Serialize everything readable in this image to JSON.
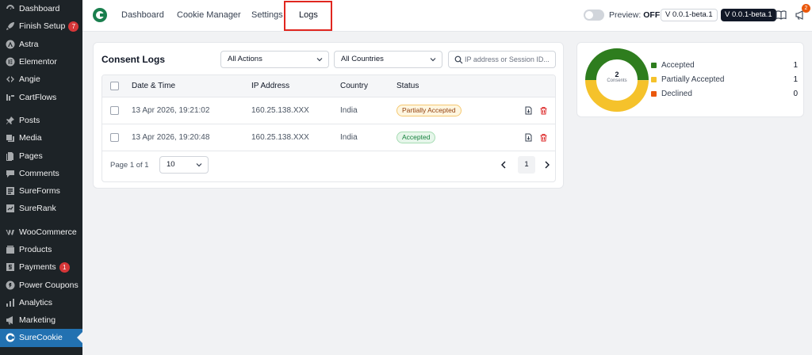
{
  "wp_sidebar": {
    "items": [
      {
        "label": "Dashboard",
        "icon": "dashboard-icon"
      },
      {
        "label": "Finish Setup",
        "icon": "rocket-icon",
        "badge": "7"
      },
      {
        "label": "Astra",
        "icon": "astra-icon"
      },
      {
        "label": "Elementor",
        "icon": "elementor-icon"
      },
      {
        "label": "Angie",
        "icon": "angie-icon"
      },
      {
        "label": "CartFlows",
        "icon": "cartflows-icon"
      },
      {
        "label": "Posts",
        "icon": "pin-icon"
      },
      {
        "label": "Media",
        "icon": "media-icon"
      },
      {
        "label": "Pages",
        "icon": "pages-icon"
      },
      {
        "label": "Comments",
        "icon": "comment-icon"
      },
      {
        "label": "SureForms",
        "icon": "sureforms-icon"
      },
      {
        "label": "SureRank",
        "icon": "surerank-icon"
      },
      {
        "label": "WooCommerce",
        "icon": "woocommerce-icon"
      },
      {
        "label": "Products",
        "icon": "products-icon"
      },
      {
        "label": "Payments",
        "icon": "payments-icon",
        "badge": "1"
      },
      {
        "label": "Power Coupons",
        "icon": "coupon-icon"
      },
      {
        "label": "Analytics",
        "icon": "analytics-icon"
      },
      {
        "label": "Marketing",
        "icon": "megaphone-icon"
      },
      {
        "label": "SureCookie",
        "icon": "surecookie-icon"
      }
    ]
  },
  "topnav": {
    "tabs": [
      {
        "label": "Dashboard"
      },
      {
        "label": "Cookie Manager"
      },
      {
        "label": "Settings"
      },
      {
        "label": "Logs"
      }
    ],
    "active_tab": "Logs",
    "preview_label": "Preview:",
    "preview_state": "OFF",
    "version_outline": "V 0.0.1-beta.1",
    "version_dark": "V 0.0.1-beta.1",
    "notification_count": "2"
  },
  "logs": {
    "title": "Consent Logs",
    "filter_actions": "All Actions",
    "filter_countries": "All Countries",
    "search_placeholder": "IP address or Session ID...",
    "columns": [
      "Date & Time",
      "IP Address",
      "Country",
      "Status"
    ],
    "rows": [
      {
        "datetime": "13 Apr 2026, 19:21:02",
        "ip": "160.25.138.XXX",
        "country": "India",
        "status": "Partially Accepted"
      },
      {
        "datetime": "13 Apr 2026, 19:20:48",
        "ip": "160.25.138.XXX",
        "country": "India",
        "status": "Accepted"
      }
    ],
    "page_info": "Page 1 of 1",
    "per_page": "10",
    "current_page": "1"
  },
  "summary": {
    "total": "2",
    "total_label": "Consents",
    "items": [
      {
        "label": "Accepted",
        "count": "1",
        "color": "#2e7d1e"
      },
      {
        "label": "Partially Accepted",
        "count": "1",
        "color": "#f5c22b"
      },
      {
        "label": "Declined",
        "count": "0",
        "color": "#ea580c"
      }
    ]
  },
  "colors": {
    "wp_sidebar_bg": "#1d2327",
    "wp_active": "#2271b1",
    "highlight": "#e0261f",
    "brand": "#1a7f4e"
  }
}
